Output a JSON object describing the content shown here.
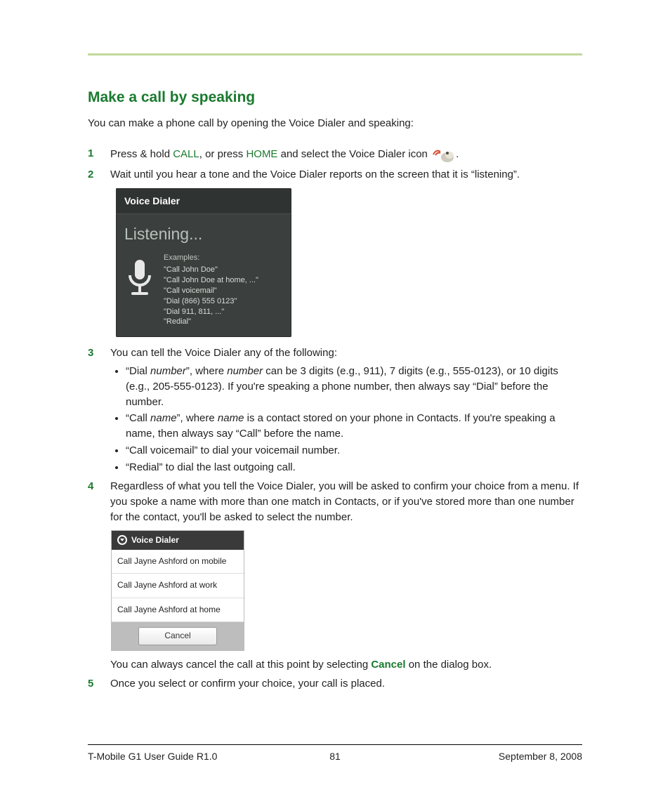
{
  "heading": "Make a call by speaking",
  "intro": "You can make a phone call by opening the Voice Dialer and speaking:",
  "steps": {
    "s1": {
      "a": "Press & hold ",
      "call": "CALL",
      "b": ", or press ",
      "home": "HOME",
      "c": " and select the Voice Dialer icon ",
      "d": "."
    },
    "s2": "Wait until you hear a tone and the Voice Dialer reports on the screen that it is “listening”.",
    "s3": {
      "lead": "You can tell the Voice Dialer any of the following:",
      "b1a": "“Dial ",
      "b1b": "number",
      "b1c": "”, where ",
      "b1d": "number",
      "b1e": " can be 3 digits (e.g., 911), 7 digits (e.g., 555-0123), or 10 digits (e.g., 205-555-0123). If you're speaking a phone number, then always say “Dial” before the number.",
      "b2a": "“Call ",
      "b2b": "name",
      "b2c": "”, where ",
      "b2d": "name",
      "b2e": " is a contact stored on your phone in Contacts. If you're speaking a name, then always say “Call” before the name.",
      "b3": "“Call voicemail” to dial your voicemail number.",
      "b4": "“Redial” to dial the last outgoing call."
    },
    "s4": {
      "p1": "Regardless of what you tell the Voice Dialer, you will be asked to confirm your choice from a menu. If you spoke a name with more than one match in Contacts, or if you've stored more than one number for the contact, you'll be asked to select the number.",
      "p2a": "You can always cancel the call at this point by selecting ",
      "p2cancel": "Cancel",
      "p2b": " on the dialog box."
    },
    "s5": "Once you select or confirm your choice, your call is placed."
  },
  "vd": {
    "title": "Voice Dialer",
    "listening": "Listening...",
    "exHeader": "Examples:",
    "ex1": "\"Call John Doe\"",
    "ex2": "\"Call John Doe at home, ...\"",
    "ex3": "\"Call voicemail\"",
    "ex4": "\"Dial (866) 555 0123\"",
    "ex5": "\"Dial 911, 811, ...\"",
    "ex6": "\"Redial\""
  },
  "confirm": {
    "title": "Voice Dialer",
    "opt1": "Call Jayne Ashford on mobile",
    "opt2": "Call Jayne Ashford at work",
    "opt3": "Call Jayne Ashford at home",
    "cancel": "Cancel"
  },
  "footer": {
    "left": "T-Mobile G1 User Guide R1.0",
    "center": "81",
    "right": "September 8, 2008"
  }
}
